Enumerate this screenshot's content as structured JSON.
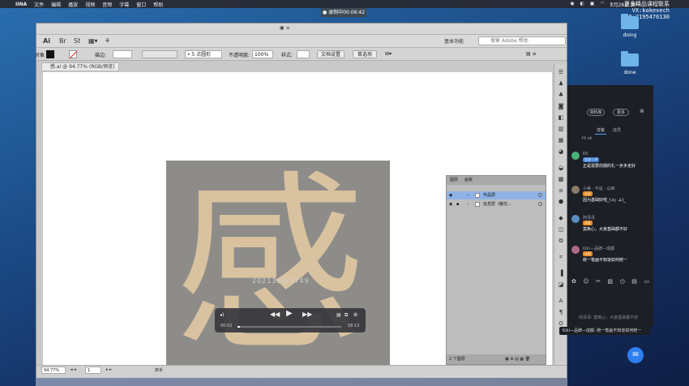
{
  "menubar": {
    "app": "IINA",
    "items": [
      "文件",
      "编辑",
      "播放",
      "视频",
      "音频",
      "字幕",
      "窗口",
      "帮助"
    ],
    "clock": "2月28日 周一"
  },
  "recording": "● 录制中00:06:42",
  "watermark": [
    "更多精品课程联系",
    "VX:kokexech",
    "QQ:3195476130"
  ],
  "desktop_icons": [
    {
      "label": "doing"
    },
    {
      "label": "done"
    }
  ],
  "illustrator": {
    "title_icon": "Ai",
    "workspace": "基本功能",
    "search_placeholder": "搜索 Adobe 帮助",
    "control": {
      "fill_label": "对象",
      "stroke_label": "描边:",
      "brush": "• 5 点圆形",
      "opacity_label": "不透明度:",
      "opacity": "100%",
      "style_label": "样式:",
      "doc_setup": "文档设置",
      "prefs": "首选项"
    },
    "doc_tab": "感.ai @ 94.77% (RGB/预览)",
    "zoom": "94.77%",
    "artboard": "1",
    "status_tool": "抓手"
  },
  "artwork": {
    "character": "感",
    "overlay_text": "2021360/5749"
  },
  "video": {
    "current": "00:02",
    "total": "58:13",
    "progress_fraction": 0.001
  },
  "layers": {
    "tab_layers": "图层",
    "tab_artboards": "画板",
    "rows": [
      {
        "name": "作品层"
      },
      {
        "name": "信息层（静交..."
      }
    ],
    "footer": "2 个图层"
  },
  "chat": {
    "btn_profile": "资料库",
    "btn_more": "更多",
    "tab_discuss": "讨论",
    "tab_members": "成员",
    "hint": "Hi ok",
    "messages": [
      {
        "user": "KK",
        "tag": "加油 Lv6",
        "text": "正是需要前期的扎一步步走好",
        "color": "#4caf7a"
      },
      {
        "user": "小美 · 平遥 · 山西",
        "tag": "认证",
        "text": "因为基础好啦_(:з」∠)_",
        "color": "#8a7b68"
      },
      {
        "user": "阿泽泽",
        "tag": "认证",
        "text": "莫焦心，大家基础都不好",
        "color": "#5a8fc2"
      },
      {
        "user": "Kiki—品牌—成都",
        "tag": "认证",
        "text": "统一笔画不知道如何统一",
        "color": "#b06a8a"
      }
    ],
    "input_hint": "阿泽泽: 莫焦心，大家基础都不好",
    "bubble": "Kiki—品牌—成都: 统一笔画不知道如何统一"
  }
}
